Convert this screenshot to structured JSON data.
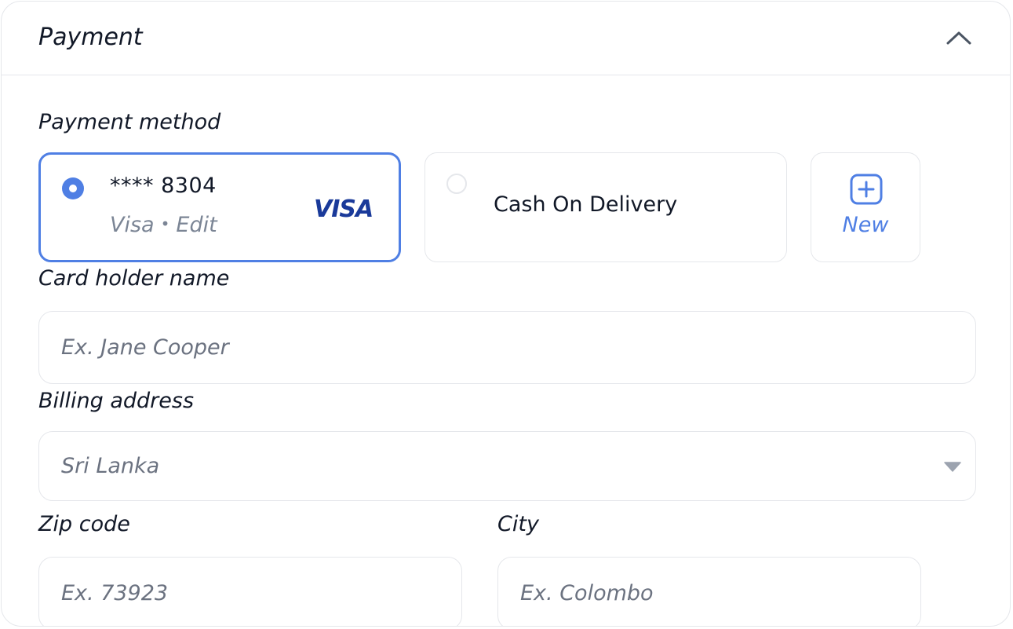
{
  "panel": {
    "title": "Payment"
  },
  "payment_method": {
    "label": "Payment method",
    "options": [
      {
        "card_number": "**** 8304",
        "brand": "Visa",
        "separator": "•",
        "edit_label": "Edit",
        "logo_text": "VISA",
        "selected": true
      },
      {
        "label": "Cash On Delivery",
        "selected": false
      }
    ],
    "new_label": "New"
  },
  "card_holder": {
    "label": "Card holder name",
    "placeholder": "Ex. Jane Cooper",
    "value": ""
  },
  "billing_address": {
    "label": "Billing address",
    "value": "Sri Lanka"
  },
  "zip": {
    "label": "Zip code",
    "placeholder": "Ex. 73923",
    "value": ""
  },
  "city": {
    "label": "City",
    "placeholder": "Ex. Colombo",
    "value": ""
  },
  "colors": {
    "accent": "#4f7fe4",
    "border": "#e5e7eb",
    "visa_blue": "#1a3a9a"
  },
  "icons": {
    "collapse": "chevron-up-icon",
    "new": "plus-square-icon",
    "select": "caret-down-icon"
  }
}
